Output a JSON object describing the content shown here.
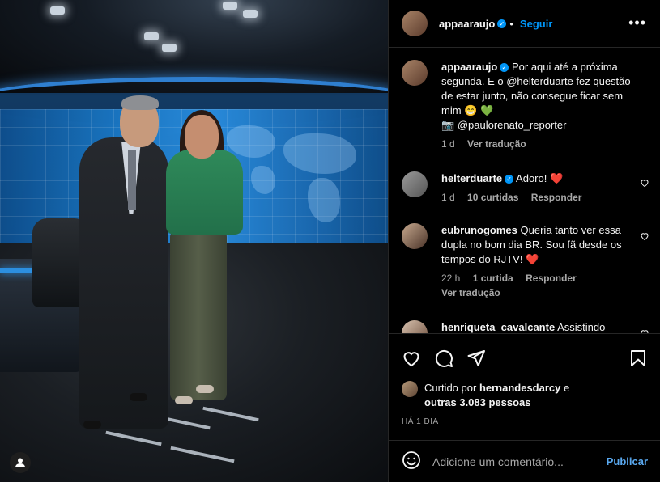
{
  "post": {
    "username": "appaaraujo",
    "follow_label": "Seguir",
    "separator": "•",
    "more_icon": "more-icon"
  },
  "caption": {
    "username": "appaaraujo",
    "text_1": "Por aqui até a próxima segunda. E o @helterduarte fez questão de estar junto, não consegue ficar sem mim",
    "emoji_1": "😁 💚",
    "camera_emoji": "📷",
    "credit": "@paulorenato_reporter",
    "time": "1 d",
    "translate": "Ver tradução"
  },
  "comments": [
    {
      "username": "helterduarte",
      "text": "Adoro!",
      "heart": "❤️",
      "time": "1 d",
      "likes": "10 curtidas",
      "reply": "Responder"
    },
    {
      "username": "eubrunogomes",
      "text": "Queria tanto ver essa dupla no bom dia BR. Sou fã desde os tempos do RJTV!",
      "heart": "❤️",
      "time": "22 h",
      "likes": "1 curtida",
      "reply": "Responder",
      "translate": "Ver tradução"
    },
    {
      "username": "henriqueta_cavalcante",
      "text": "Assistindo"
    }
  ],
  "likes": {
    "prefix": "Curtido por",
    "user": "hernandesdarcy",
    "and": "e",
    "others": "outras 3.083 pessoas"
  },
  "post_time": "HÁ 1 DIA",
  "composer": {
    "placeholder": "Adicione um comentário...",
    "publish": "Publicar"
  },
  "colors": {
    "accent": "#0095f6",
    "heart": "#ff3040",
    "green_heart": "#2ecc40"
  }
}
